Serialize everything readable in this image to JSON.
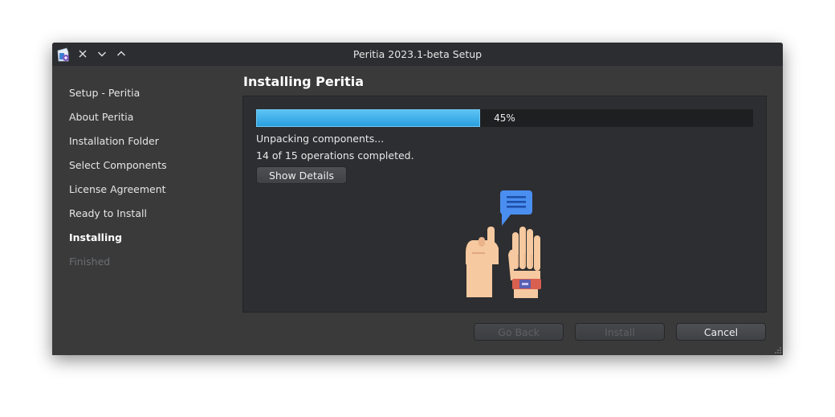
{
  "window": {
    "title": "Peritia 2023.1-beta Setup",
    "icons": [
      "app-icon",
      "close-icon",
      "chevron-down-icon",
      "chevron-up-icon"
    ]
  },
  "sidebar": {
    "items": [
      {
        "label": "Setup - Peritia",
        "state": "done"
      },
      {
        "label": "About Peritia",
        "state": "done"
      },
      {
        "label": "Installation Folder",
        "state": "done"
      },
      {
        "label": "Select Components",
        "state": "done"
      },
      {
        "label": "License Agreement",
        "state": "done"
      },
      {
        "label": "Ready to Install",
        "state": "done"
      },
      {
        "label": "Installing",
        "state": "current"
      },
      {
        "label": "Finished",
        "state": "disabled"
      }
    ]
  },
  "page": {
    "title": "Installing Peritia",
    "progress": {
      "value": 45,
      "text": "45%"
    },
    "status_line": "Unpacking components...",
    "operations_line": "14 of 15 operations completed.",
    "show_details_label": "Show Details"
  },
  "footer": {
    "back_label": "Go Back",
    "install_label": "Install",
    "cancel_label": "Cancel"
  },
  "colors": {
    "accent": "#3aaee8",
    "window_bg": "#3a3a3a",
    "panel_bg": "#2d2e31",
    "titlebar_bg": "#2b2d30"
  }
}
